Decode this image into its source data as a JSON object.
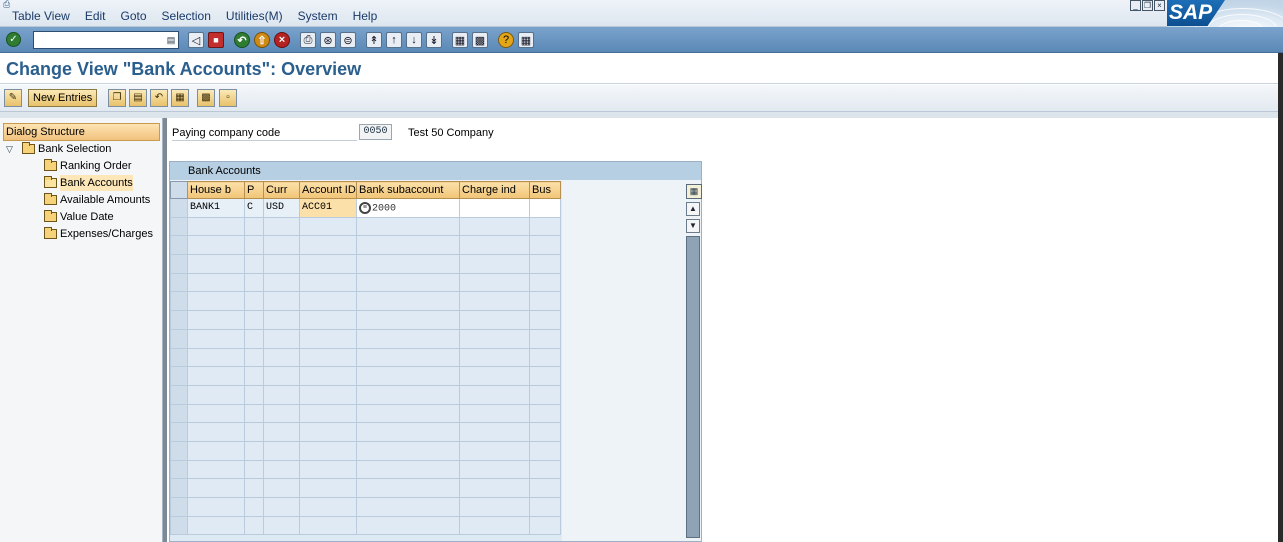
{
  "menu": {
    "items": [
      {
        "label": "Table View"
      },
      {
        "label": "Edit"
      },
      {
        "label": "Goto"
      },
      {
        "label": "Selection"
      },
      {
        "label": "Utilities(M)"
      },
      {
        "label": "System"
      },
      {
        "label": "Help"
      }
    ]
  },
  "brand": {
    "logo": "SAP"
  },
  "command_field": {
    "value": ""
  },
  "title": "Change View \"Bank Accounts\": Overview",
  "app_toolbar": {
    "new_entries_label": "New Entries"
  },
  "dialog_structure": {
    "header": "Dialog Structure",
    "root": "Bank Selection",
    "children": [
      {
        "label": "Ranking Order"
      },
      {
        "label": "Bank Accounts"
      },
      {
        "label": "Available Amounts"
      },
      {
        "label": "Value Date"
      },
      {
        "label": "Expenses/Charges"
      }
    ]
  },
  "header_fields": {
    "paying_company_code_label": "Paying company code",
    "paying_company_code_value": "0050",
    "company_name": "Test 50 Company"
  },
  "table": {
    "title": "Bank Accounts",
    "columns": [
      {
        "label": "House b"
      },
      {
        "label": "P"
      },
      {
        "label": "Curr"
      },
      {
        "label": "Account ID"
      },
      {
        "label": "Bank subaccount"
      },
      {
        "label": "Charge ind"
      },
      {
        "label": "Bus"
      }
    ],
    "rows": [
      {
        "house_bank": "BANK1",
        "p": "C",
        "curr": "USD",
        "account_id": "ACC01",
        "bank_subaccount": "2000",
        "charge_ind": "",
        "bus": ""
      }
    ]
  },
  "colors": {
    "title_blue": "#2b5f8e",
    "toolbar_blue": "#5b88b6",
    "header_orange": "#f1c477",
    "grid_blue": "#dfeaf4"
  }
}
